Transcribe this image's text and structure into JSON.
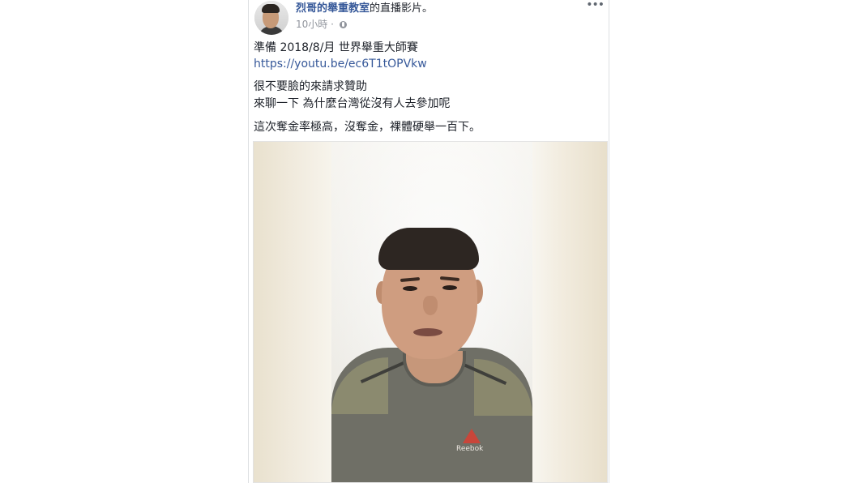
{
  "post": {
    "page_name": "烈哥的舉重教室",
    "header_suffix": "的直播影片。",
    "time": "10小時",
    "separator": "·",
    "more_label": "•••",
    "line_1": "準備 2018/8/月 世界舉重大師賽",
    "link": "https://youtu.be/ec6T1tOPVkw",
    "line_2": "很不要臉的來請求贊助",
    "line_3": "來聊一下 為什麼台灣從沒有人去參加呢",
    "line_4": "這次奪金率極高，沒奪金，裸體硬舉一百下。"
  },
  "video": {
    "shirt_logo": "Reebok"
  },
  "icons": {
    "privacy": "globe-icon",
    "menu": "more-icon"
  },
  "colors": {
    "link": "#365899",
    "text": "#1d2129",
    "meta": "#90949c"
  }
}
